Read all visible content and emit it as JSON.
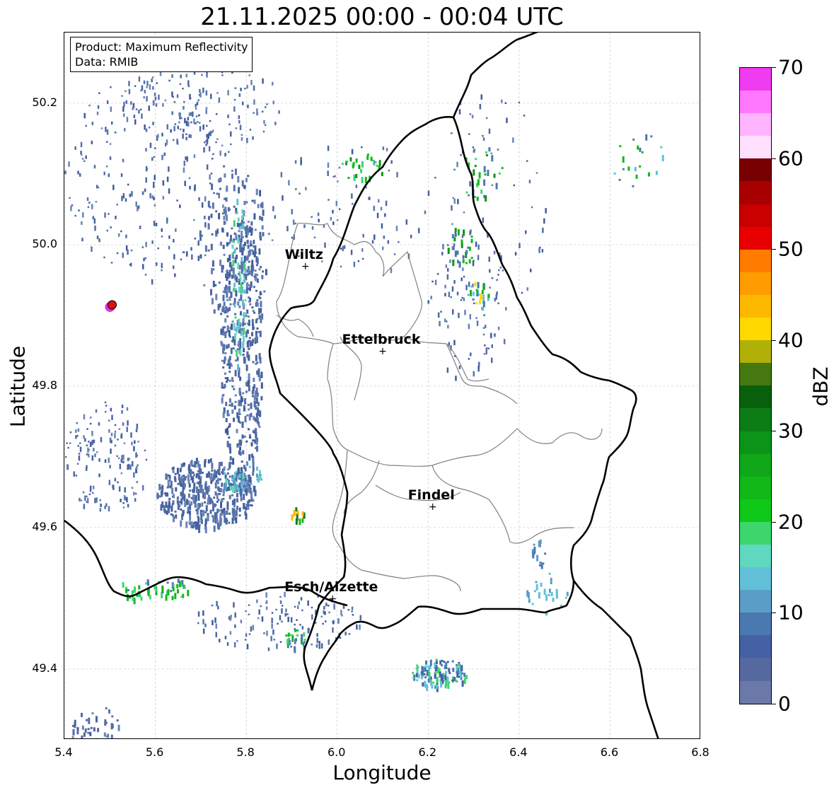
{
  "title": "21.11.2025 00:00 - 00:04 UTC",
  "info": {
    "line1": "Product: Maximum Reflectivity",
    "line2": "Data: RMIB"
  },
  "axes": {
    "xlabel": "Longitude",
    "ylabel": "Latitude",
    "xlim": [
      5.4,
      6.8
    ],
    "ylim": [
      49.3,
      50.3
    ],
    "xticks": [
      "5.4",
      "5.6",
      "5.8",
      "6.0",
      "6.2",
      "6.4",
      "6.6",
      "6.8"
    ],
    "yticks": [
      "49.4",
      "49.6",
      "49.8",
      "50.0",
      "50.2"
    ]
  },
  "colorbar": {
    "label": "dBZ",
    "ticks": [
      "0",
      "10",
      "20",
      "30",
      "40",
      "50",
      "60",
      "70"
    ],
    "colors": [
      "#6b79a8",
      "#5568a0",
      "#4560a5",
      "#4a78b0",
      "#5a9ec8",
      "#62c0d8",
      "#60d8c0",
      "#3cd66c",
      "#10c818",
      "#10b818",
      "#10a818",
      "#0c9418",
      "#0c7c14",
      "#08600c",
      "#467810",
      "#b0b008",
      "#ffd800",
      "#ffb800",
      "#ff9c00",
      "#ff7c00",
      "#e80000",
      "#c80000",
      "#a80000",
      "#780000",
      "#ffe0ff",
      "#ffb4ff",
      "#ff78ff",
      "#f03cf0"
    ]
  },
  "cities": [
    {
      "name": "Wiltz",
      "lon": 5.93,
      "lat": 49.97
    },
    {
      "name": "Ettelbruck",
      "lon": 6.1,
      "lat": 49.85
    },
    {
      "name": "Findel",
      "lon": 6.21,
      "lat": 49.63
    },
    {
      "name": "Esch/Alzette",
      "lon": 5.99,
      "lat": 49.5
    }
  ],
  "radar_marker": {
    "lon": 5.505,
    "lat": 49.915,
    "color": "#dd1111"
  }
}
